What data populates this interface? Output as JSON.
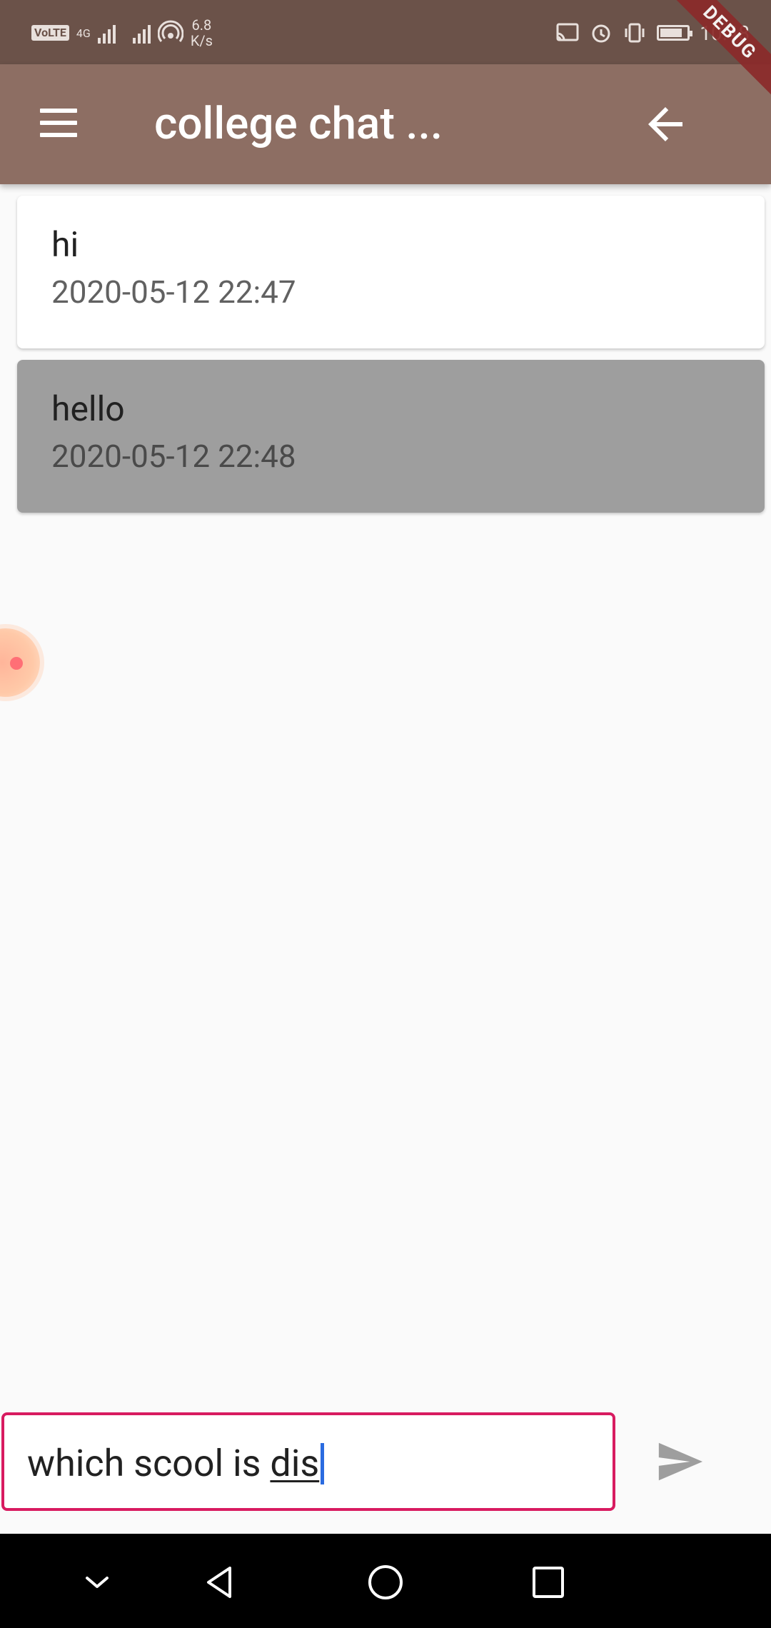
{
  "status_bar": {
    "volte": "VoLTE",
    "network": "4G",
    "speed_value": "6.8",
    "speed_unit": "K/s",
    "time": "10:48"
  },
  "app_bar": {
    "title": "college chat ...",
    "debug_banner": "DEBUG"
  },
  "messages": [
    {
      "text": "hi",
      "time": "2020-05-12 22:47"
    },
    {
      "text": "hello",
      "time": "2020-05-12 22:48"
    }
  ],
  "composer": {
    "text_before": "which scool is ",
    "text_underlined": "dis"
  },
  "colors": {
    "status_bar": "#6b5249",
    "app_bar": "#8d6e63",
    "input_border": "#d81b60",
    "selected_message": "#9e9e9e"
  },
  "icons": [
    "menu-icon",
    "back-arrow-icon",
    "send-icon",
    "nav-back-icon",
    "nav-home-icon",
    "nav-recents-icon",
    "nav-hide-icon"
  ]
}
